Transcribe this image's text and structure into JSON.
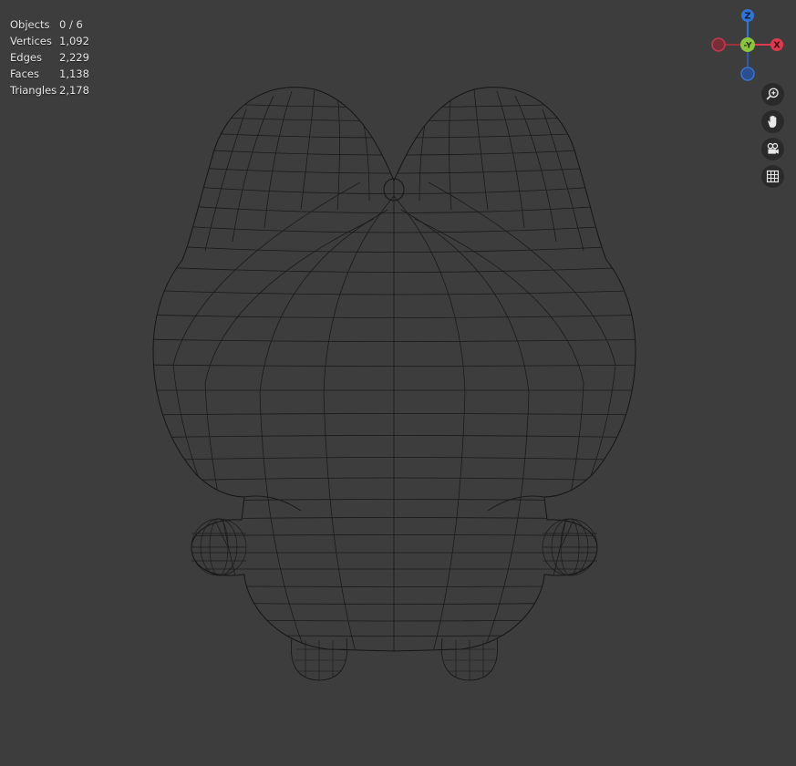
{
  "stats": [
    {
      "label": "Objects",
      "value": "0 / 6"
    },
    {
      "label": "Vertices",
      "value": "1,092"
    },
    {
      "label": "Edges",
      "value": "2,229"
    },
    {
      "label": "Faces",
      "value": "1,138"
    },
    {
      "label": "Triangles",
      "value": "2,178"
    }
  ],
  "gizmo": {
    "z_label": "Z",
    "y_label": "-Y",
    "x_label": "X",
    "z_color": "#2f76d6",
    "y_color": "#8bc53f",
    "x_color": "#e0394d",
    "neg_x_color": "#9c3040",
    "neg_z_color": "#2a5cab"
  },
  "nav_tools": [
    {
      "name": "zoom-icon"
    },
    {
      "name": "pan-hand-icon"
    },
    {
      "name": "camera-icon"
    },
    {
      "name": "grid-icon"
    }
  ]
}
